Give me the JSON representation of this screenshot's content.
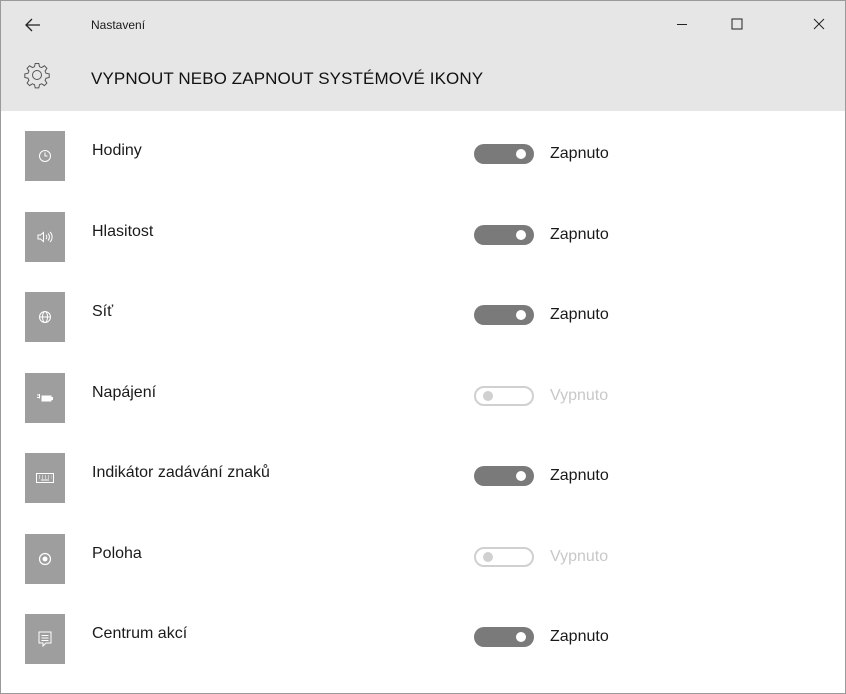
{
  "window": {
    "title": "Nastavení"
  },
  "header": {
    "title": "VYPNOUT NEBO ZAPNOUT SYSTÉMOVÉ IKONY",
    "icon": "gear-icon"
  },
  "items": [
    {
      "label": "Hodiny",
      "icon": "clock-icon",
      "on": true,
      "state": "Zapnuto"
    },
    {
      "label": "Hlasitost",
      "icon": "speaker-icon",
      "on": true,
      "state": "Zapnuto"
    },
    {
      "label": "Síť",
      "icon": "globe-icon",
      "on": true,
      "state": "Zapnuto"
    },
    {
      "label": "Napájení",
      "icon": "battery-icon",
      "on": false,
      "state": "Vypnuto"
    },
    {
      "label": "Indikátor zadávání znaků",
      "icon": "keyboard-icon",
      "on": true,
      "state": "Zapnuto"
    },
    {
      "label": "Poloha",
      "icon": "location-icon",
      "on": false,
      "state": "Vypnuto"
    },
    {
      "label": "Centrum akcí",
      "icon": "action-center-icon",
      "on": true,
      "state": "Zapnuto"
    }
  ],
  "colors": {
    "tile": "#9e9e9e",
    "toggle_on": "#7a7a7a",
    "toggle_off": "#d0d0d0",
    "chrome": "#e6e6e6"
  }
}
